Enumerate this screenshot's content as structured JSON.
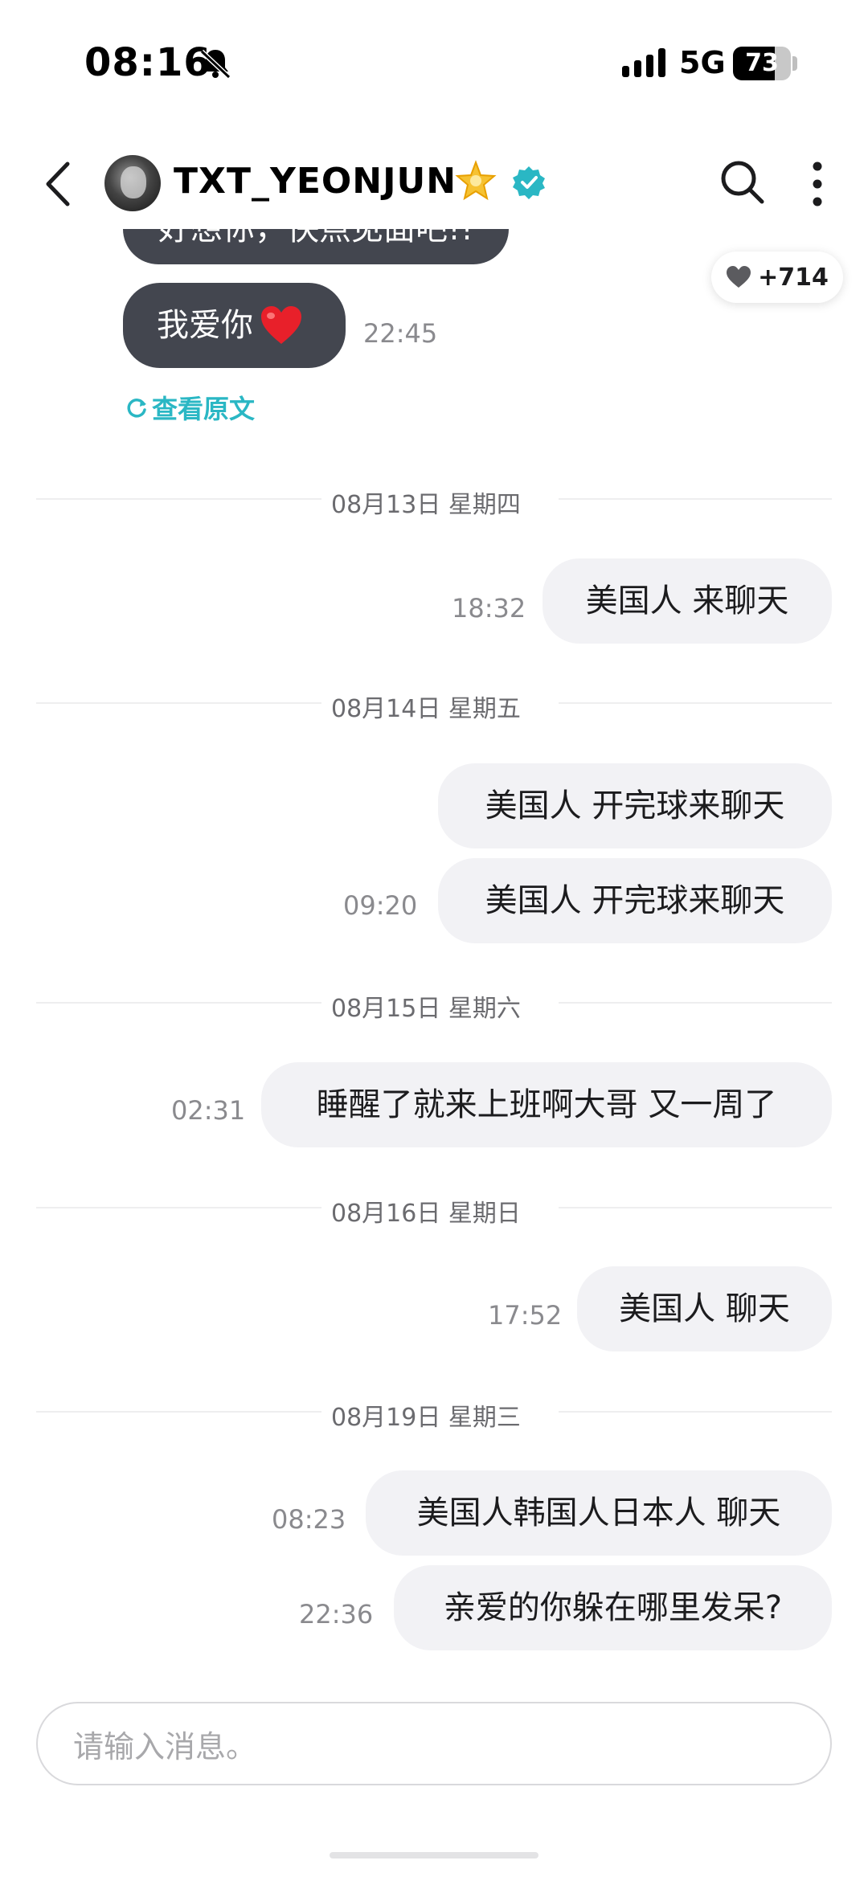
{
  "status_bar": {
    "time": "08:16",
    "network": "5G",
    "battery": "73"
  },
  "header": {
    "title": "TXT_YEONJUN",
    "icons": [
      "back-arrow-icon",
      "avatar",
      "glowing-star-icon",
      "verified-badge-icon",
      "search-icon",
      "more-vertical-icon"
    ]
  },
  "messages_top": {
    "partial_text": "好想你，快点见面吧!!",
    "love_text": "我爱你",
    "love_time": "22:45",
    "translate_link": "查看原文"
  },
  "likes": {
    "count": "+714"
  },
  "days": [
    {
      "date": "08月13日 星期四",
      "messages": [
        {
          "text": "美国人 来聊天",
          "time": "18:32"
        }
      ]
    },
    {
      "date": "08月14日 星期五",
      "messages": [
        {
          "text": "美国人 开完球来聊天",
          "time": ""
        },
        {
          "text": "美国人 开完球来聊天",
          "time": "09:20"
        }
      ]
    },
    {
      "date": "08月15日 星期六",
      "messages": [
        {
          "text": "睡醒了就来上班啊大哥 又一周了",
          "time": "02:31"
        }
      ]
    },
    {
      "date": "08月16日 星期日",
      "messages": [
        {
          "text": "美国人 聊天",
          "time": "17:52"
        }
      ]
    },
    {
      "date": "08月19日 星期三",
      "messages": [
        {
          "text": "美国人韩国人日本人 聊天",
          "time": "08:23"
        },
        {
          "text": "亲爱的你躲在哪里发呆?",
          "time": "22:36"
        }
      ]
    }
  ],
  "composer": {
    "placeholder": "请输入消息。"
  },
  "colors": {
    "incoming_bubble": "#43464f",
    "outgoing_bubble": "#f2f2f5",
    "accent": "#2ab7c4",
    "heart": "#e8202a"
  }
}
